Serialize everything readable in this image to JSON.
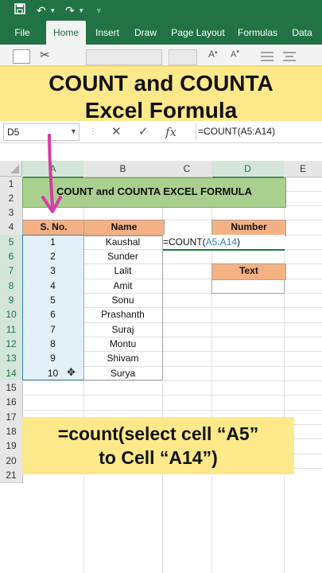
{
  "ribbon": {
    "tabs": [
      {
        "label": "File"
      },
      {
        "label": "Home"
      },
      {
        "label": "Insert"
      },
      {
        "label": "Draw"
      },
      {
        "label": "Page Layout"
      },
      {
        "label": "Formulas"
      },
      {
        "label": "Data"
      }
    ],
    "active_tab": "Home"
  },
  "banner_top": {
    "line1": "COUNT and COUNTA",
    "line2": "Excel Formula"
  },
  "formula_bar": {
    "name_box": "D5",
    "formula": "=COUNT(A5:A14)"
  },
  "columns": [
    "A",
    "B",
    "C",
    "D",
    "E"
  ],
  "rows": [
    "1",
    "2",
    "3",
    "4",
    "5",
    "6",
    "7",
    "8",
    "9",
    "10",
    "11",
    "12",
    "13",
    "14",
    "15",
    "16",
    "17",
    "18",
    "19",
    "20",
    "21"
  ],
  "sheet": {
    "title": "COUNT and COUNTA EXCEL FORMULA",
    "header_sno": "S. No.",
    "header_name": "Name",
    "serials": [
      "1",
      "2",
      "3",
      "4",
      "5",
      "6",
      "7",
      "8",
      "9",
      "10"
    ],
    "names": [
      "Kaushal",
      "Sunder",
      "Lalit",
      "Amit",
      "Sonu",
      "Prashanth",
      "Suraj",
      "Montu",
      "Shivam",
      "Surya"
    ],
    "c5_text": "=COUNT(",
    "c5_ref": "A5:A14",
    "c5_close": ")",
    "number_label": "Number",
    "text_label": "Text"
  },
  "banner_bottom": {
    "line1": "=count(select cell “A5”",
    "line2": "to Cell “A14”)"
  },
  "colors": {
    "excel_green": "#217346",
    "orange": "#f4b183",
    "title_green": "#a9d08e",
    "banner_yellow": "#fde98a",
    "selection_blue": "#2e7fbd",
    "arrow_pink": "#d63ca6"
  }
}
